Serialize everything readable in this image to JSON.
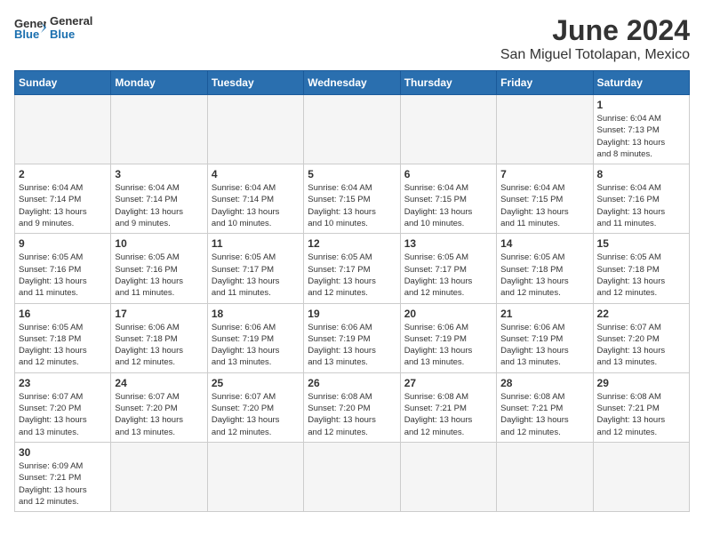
{
  "header": {
    "logo_general": "General",
    "logo_blue": "Blue",
    "month_title": "June 2024",
    "subtitle": "San Miguel Totolapan, Mexico"
  },
  "days_of_week": [
    "Sunday",
    "Monday",
    "Tuesday",
    "Wednesday",
    "Thursday",
    "Friday",
    "Saturday"
  ],
  "weeks": [
    [
      {
        "day": "",
        "info": ""
      },
      {
        "day": "",
        "info": ""
      },
      {
        "day": "",
        "info": ""
      },
      {
        "day": "",
        "info": ""
      },
      {
        "day": "",
        "info": ""
      },
      {
        "day": "",
        "info": ""
      },
      {
        "day": "1",
        "info": "Sunrise: 6:04 AM\nSunset: 7:13 PM\nDaylight: 13 hours\nand 8 minutes."
      }
    ],
    [
      {
        "day": "2",
        "info": "Sunrise: 6:04 AM\nSunset: 7:14 PM\nDaylight: 13 hours\nand 9 minutes."
      },
      {
        "day": "3",
        "info": "Sunrise: 6:04 AM\nSunset: 7:14 PM\nDaylight: 13 hours\nand 9 minutes."
      },
      {
        "day": "4",
        "info": "Sunrise: 6:04 AM\nSunset: 7:14 PM\nDaylight: 13 hours\nand 10 minutes."
      },
      {
        "day": "5",
        "info": "Sunrise: 6:04 AM\nSunset: 7:15 PM\nDaylight: 13 hours\nand 10 minutes."
      },
      {
        "day": "6",
        "info": "Sunrise: 6:04 AM\nSunset: 7:15 PM\nDaylight: 13 hours\nand 10 minutes."
      },
      {
        "day": "7",
        "info": "Sunrise: 6:04 AM\nSunset: 7:15 PM\nDaylight: 13 hours\nand 11 minutes."
      },
      {
        "day": "8",
        "info": "Sunrise: 6:04 AM\nSunset: 7:16 PM\nDaylight: 13 hours\nand 11 minutes."
      }
    ],
    [
      {
        "day": "9",
        "info": "Sunrise: 6:05 AM\nSunset: 7:16 PM\nDaylight: 13 hours\nand 11 minutes."
      },
      {
        "day": "10",
        "info": "Sunrise: 6:05 AM\nSunset: 7:16 PM\nDaylight: 13 hours\nand 11 minutes."
      },
      {
        "day": "11",
        "info": "Sunrise: 6:05 AM\nSunset: 7:17 PM\nDaylight: 13 hours\nand 11 minutes."
      },
      {
        "day": "12",
        "info": "Sunrise: 6:05 AM\nSunset: 7:17 PM\nDaylight: 13 hours\nand 12 minutes."
      },
      {
        "day": "13",
        "info": "Sunrise: 6:05 AM\nSunset: 7:17 PM\nDaylight: 13 hours\nand 12 minutes."
      },
      {
        "day": "14",
        "info": "Sunrise: 6:05 AM\nSunset: 7:18 PM\nDaylight: 13 hours\nand 12 minutes."
      },
      {
        "day": "15",
        "info": "Sunrise: 6:05 AM\nSunset: 7:18 PM\nDaylight: 13 hours\nand 12 minutes."
      }
    ],
    [
      {
        "day": "16",
        "info": "Sunrise: 6:05 AM\nSunset: 7:18 PM\nDaylight: 13 hours\nand 12 minutes."
      },
      {
        "day": "17",
        "info": "Sunrise: 6:06 AM\nSunset: 7:18 PM\nDaylight: 13 hours\nand 12 minutes."
      },
      {
        "day": "18",
        "info": "Sunrise: 6:06 AM\nSunset: 7:19 PM\nDaylight: 13 hours\nand 13 minutes."
      },
      {
        "day": "19",
        "info": "Sunrise: 6:06 AM\nSunset: 7:19 PM\nDaylight: 13 hours\nand 13 minutes."
      },
      {
        "day": "20",
        "info": "Sunrise: 6:06 AM\nSunset: 7:19 PM\nDaylight: 13 hours\nand 13 minutes."
      },
      {
        "day": "21",
        "info": "Sunrise: 6:06 AM\nSunset: 7:19 PM\nDaylight: 13 hours\nand 13 minutes."
      },
      {
        "day": "22",
        "info": "Sunrise: 6:07 AM\nSunset: 7:20 PM\nDaylight: 13 hours\nand 13 minutes."
      }
    ],
    [
      {
        "day": "23",
        "info": "Sunrise: 6:07 AM\nSunset: 7:20 PM\nDaylight: 13 hours\nand 13 minutes."
      },
      {
        "day": "24",
        "info": "Sunrise: 6:07 AM\nSunset: 7:20 PM\nDaylight: 13 hours\nand 13 minutes."
      },
      {
        "day": "25",
        "info": "Sunrise: 6:07 AM\nSunset: 7:20 PM\nDaylight: 13 hours\nand 12 minutes."
      },
      {
        "day": "26",
        "info": "Sunrise: 6:08 AM\nSunset: 7:20 PM\nDaylight: 13 hours\nand 12 minutes."
      },
      {
        "day": "27",
        "info": "Sunrise: 6:08 AM\nSunset: 7:21 PM\nDaylight: 13 hours\nand 12 minutes."
      },
      {
        "day": "28",
        "info": "Sunrise: 6:08 AM\nSunset: 7:21 PM\nDaylight: 13 hours\nand 12 minutes."
      },
      {
        "day": "29",
        "info": "Sunrise: 6:08 AM\nSunset: 7:21 PM\nDaylight: 13 hours\nand 12 minutes."
      }
    ],
    [
      {
        "day": "30",
        "info": "Sunrise: 6:09 AM\nSunset: 7:21 PM\nDaylight: 13 hours\nand 12 minutes."
      },
      {
        "day": "",
        "info": ""
      },
      {
        "day": "",
        "info": ""
      },
      {
        "day": "",
        "info": ""
      },
      {
        "day": "",
        "info": ""
      },
      {
        "day": "",
        "info": ""
      },
      {
        "day": "",
        "info": ""
      }
    ]
  ]
}
